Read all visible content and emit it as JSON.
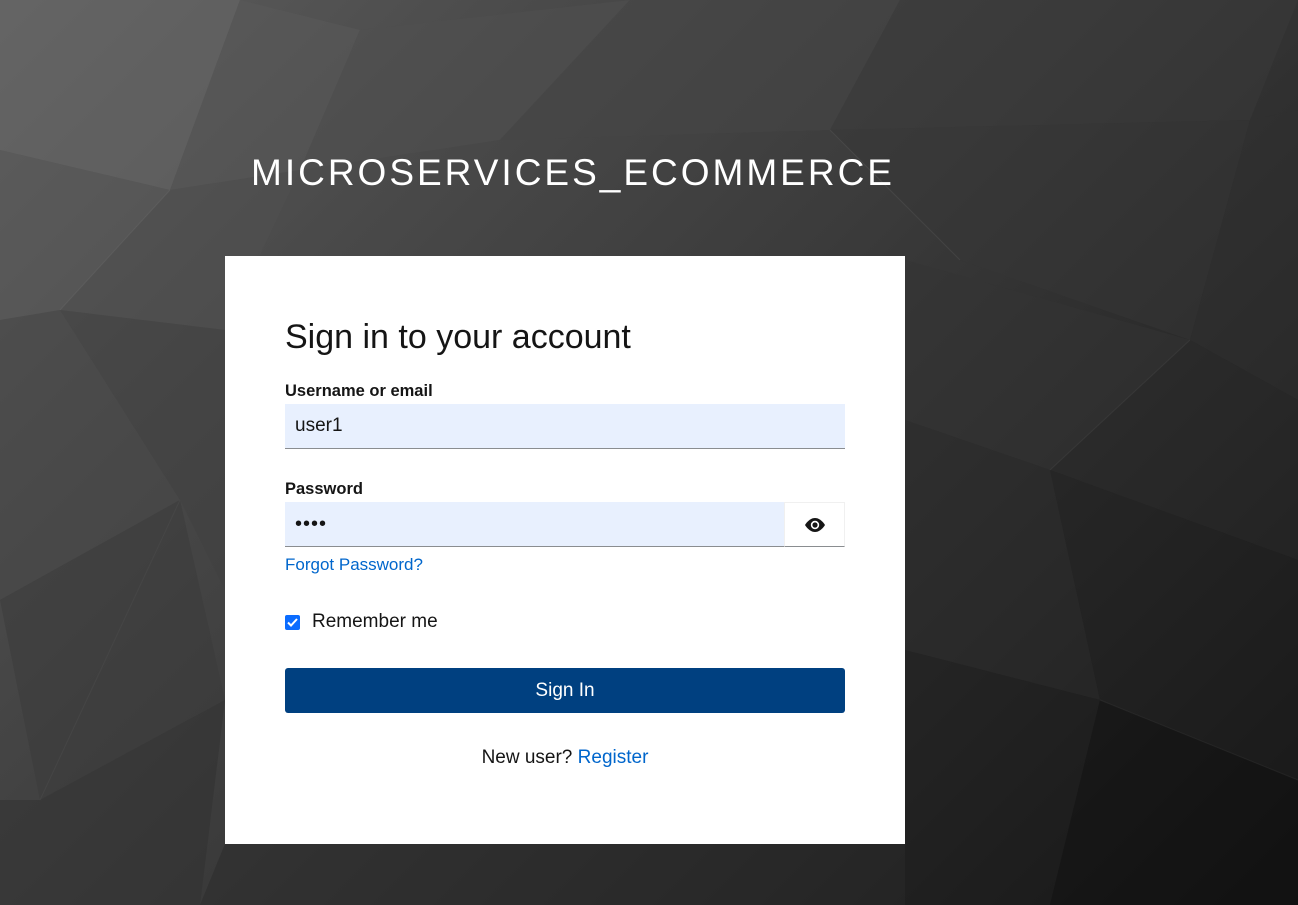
{
  "brand": {
    "title": "MICROSERVICES_ECOMMERCE"
  },
  "login": {
    "heading": "Sign in to your account",
    "username_label": "Username or email",
    "username_value": "user1",
    "password_label": "Password",
    "password_masked": "••••",
    "forgot_password": "Forgot Password?",
    "remember_me": "Remember me",
    "remember_checked": true,
    "sign_in_button": "Sign In",
    "new_user_text": "New user?",
    "register_link": "Register"
  },
  "icons": {
    "password_toggle": "eye-icon",
    "checkbox": "checkmark-icon"
  },
  "colors": {
    "primary_button": "#004080",
    "link": "#0066cc",
    "input_background": "#e8f0fe",
    "checkbox": "#0b6cff"
  }
}
